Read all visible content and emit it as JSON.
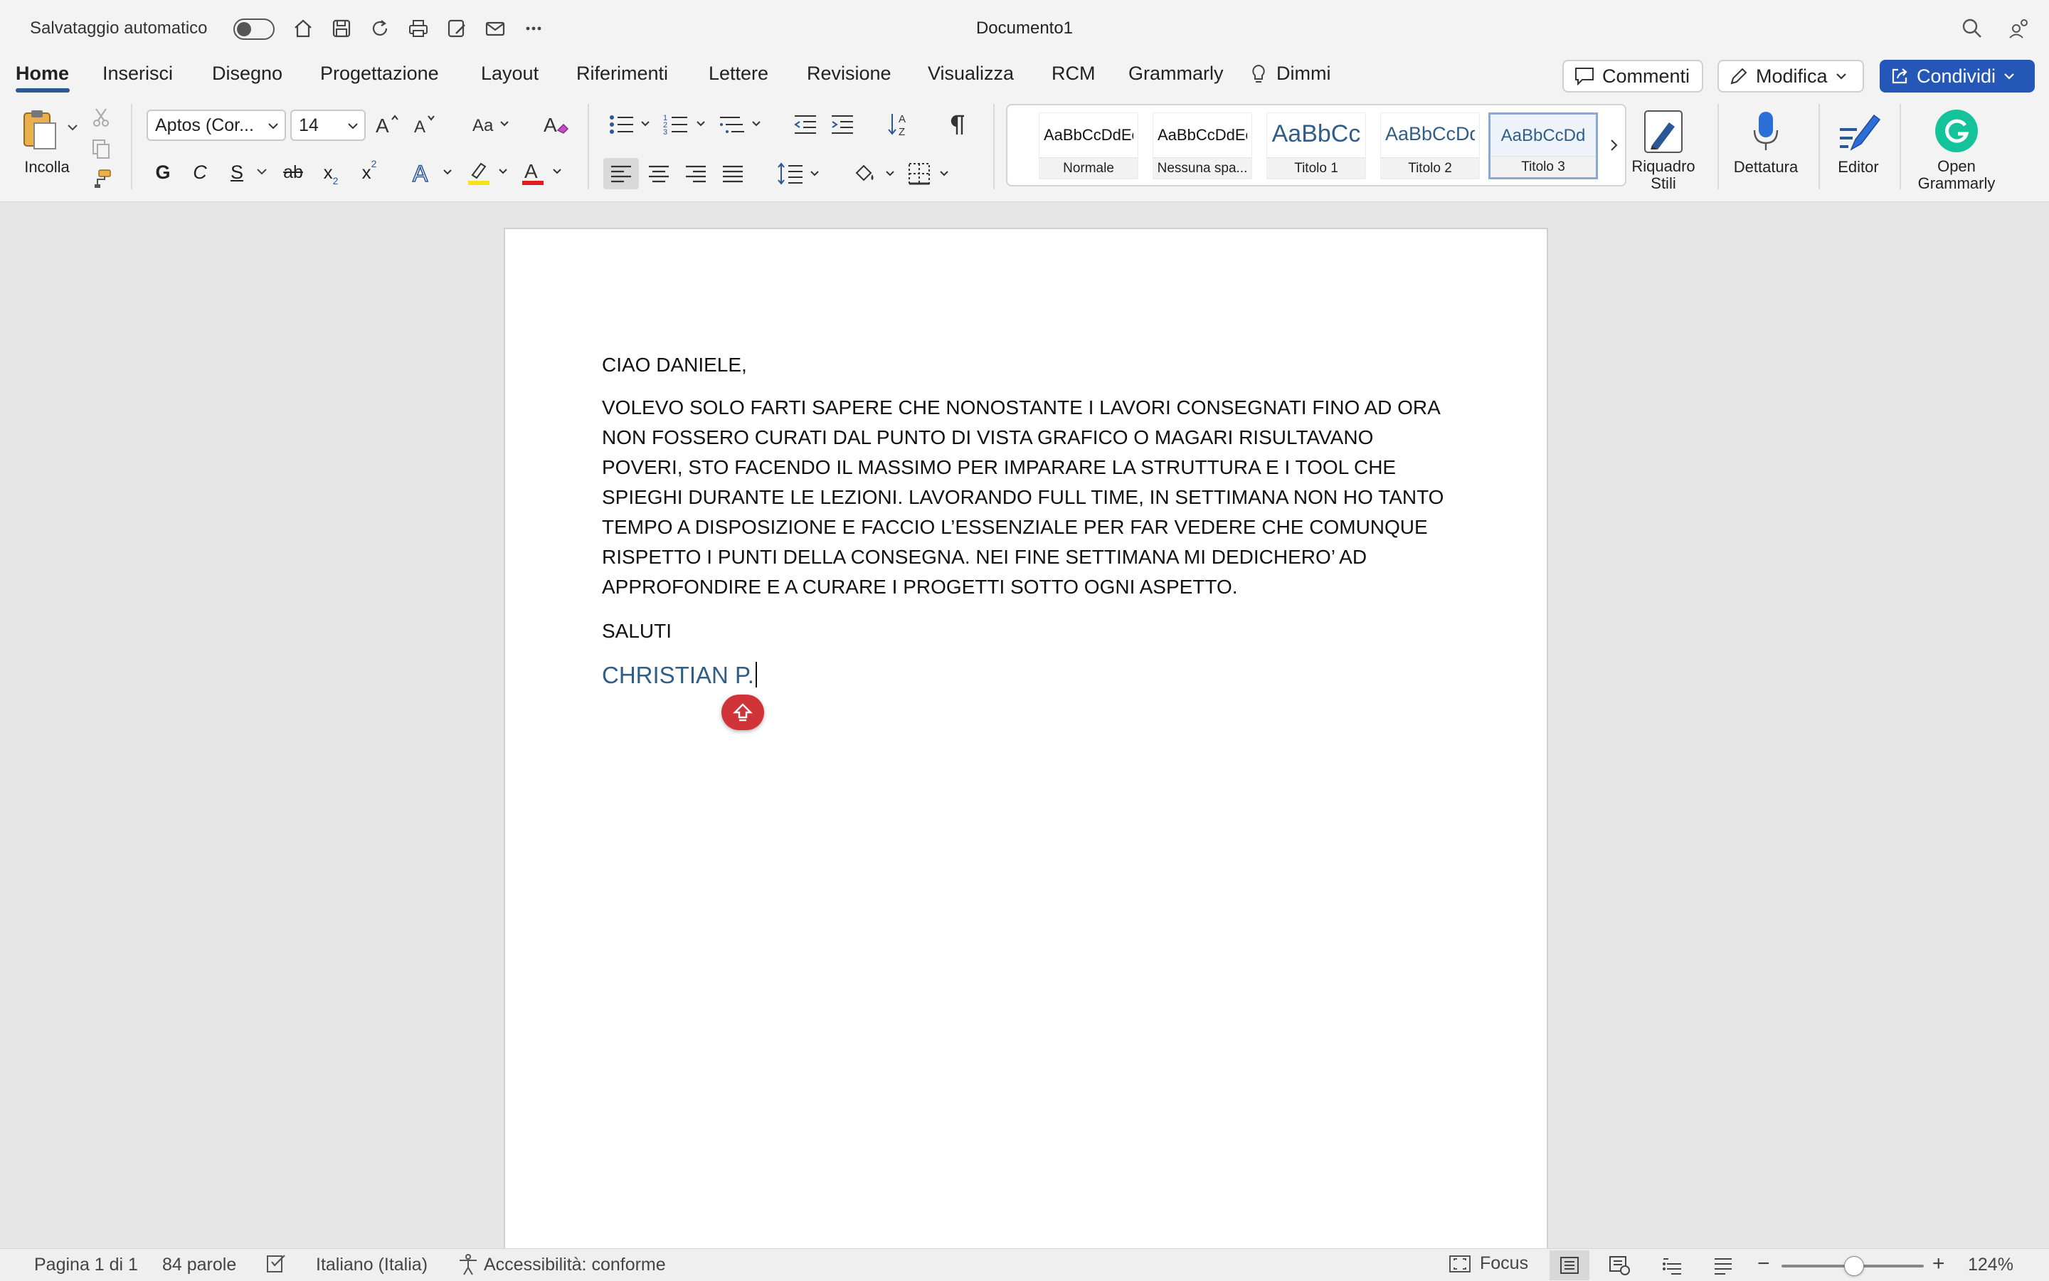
{
  "titlebar": {
    "autosave_label": "Salvataggio automatico",
    "document_title": "Documento1",
    "quick_access_icons": [
      "home-icon",
      "save-icon",
      "redo-icon",
      "print-icon",
      "save-as-icon",
      "mail-icon",
      "more-icon"
    ],
    "right_icons": [
      "search-icon",
      "share-people-icon"
    ]
  },
  "tabs": [
    {
      "label": "Home",
      "active": true
    },
    {
      "label": "Inserisci"
    },
    {
      "label": "Disegno"
    },
    {
      "label": "Progettazione"
    },
    {
      "label": "Layout"
    },
    {
      "label": "Riferimenti"
    },
    {
      "label": "Lettere"
    },
    {
      "label": "Revisione"
    },
    {
      "label": "Visualizza"
    },
    {
      "label": "RCM"
    },
    {
      "label": "Grammarly"
    },
    {
      "label": "Dimmi"
    }
  ],
  "actions": {
    "comments": "Commenti",
    "edit": "Modifica",
    "share": "Condividi"
  },
  "ribbon": {
    "paste_label": "Incolla",
    "font_name": "Aptos (Cor...",
    "font_size": "14",
    "font_format_buttons": [
      "G",
      "C",
      "S",
      "ab",
      "x",
      "x"
    ],
    "styles": [
      {
        "preview": "AaBbCcDdEe",
        "name": "Normale"
      },
      {
        "preview": "AaBbCcDdEe",
        "name": "Nessuna spa..."
      },
      {
        "preview": "AaBbCc",
        "name": "Titolo 1"
      },
      {
        "preview": "AaBbCcDd",
        "name": "Titolo 2"
      },
      {
        "preview": "AaBbCcDd",
        "name": "Titolo 3",
        "selected": true
      }
    ],
    "styles_pane_label": "Riquadro\nStili",
    "dictation_label": "Dettatura",
    "editor_label": "Editor",
    "grammarly_label": "Open\nGrammarly"
  },
  "colors": {
    "accent": "#2b5797",
    "share_button": "#2457b8",
    "highlight_yellow": "#f5e21b",
    "font_red": "#e21b1b",
    "signature_blue": "#2f5e88",
    "grammarly_green": "#15c39a",
    "float_button_red": "#d13438"
  },
  "document": {
    "greeting": "CIAO DANIELE,",
    "body": "VOLEVO SOLO FARTI SAPERE CHE NONOSTANTE I LAVORI CONSEGNATI FINO AD ORA NON FOSSERO CURATI DAL PUNTO DI VISTA GRAFICO O MAGARI RISULTAVANO POVERI, STO FACENDO IL MASSIMO PER IMPARARE LA STRUTTURA E I TOOL CHE SPIEGHI DURANTE LE LEZIONI. LAVORANDO FULL TIME, IN SETTIMANA NON HO TANTO TEMPO A DISPOSIZIONE E FACCIO L’ESSENZIALE PER FAR VEDERE CHE COMUNQUE RISPETTO I PUNTI DELLA CONSEGNA. NEI FINE SETTIMANA MI DEDICHERO’ AD APPROFONDIRE E A CURARE I PROGETTI SOTTO OGNI ASPETTO.",
    "closing": "SALUTI",
    "signature": "CHRISTIAN P."
  },
  "statusbar": {
    "page": "Pagina 1 di 1",
    "words": "84 parole",
    "language": "Italiano (Italia)",
    "accessibility": "Accessibilità: conforme",
    "focus": "Focus",
    "zoom": "124%",
    "zoom_level_percent": 124
  }
}
